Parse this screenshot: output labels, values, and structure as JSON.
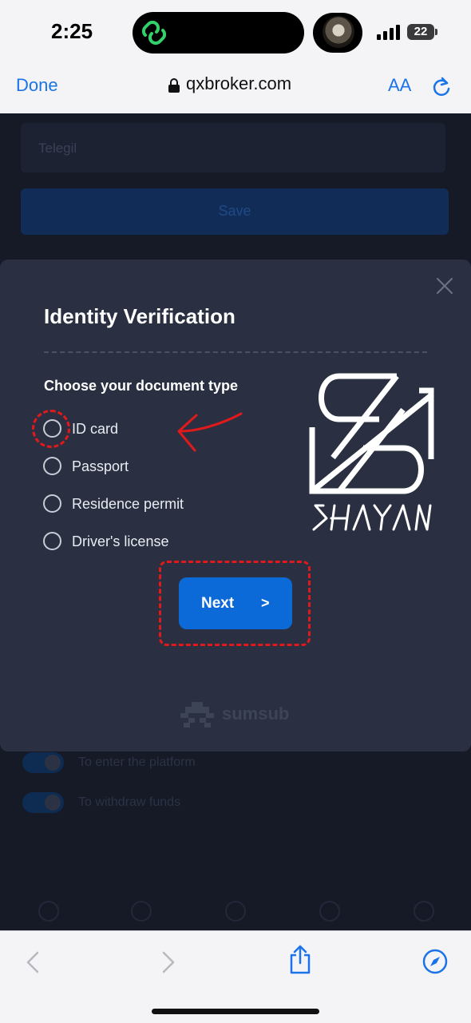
{
  "status_bar": {
    "time": "2:25",
    "battery": "22"
  },
  "browser": {
    "done_label": "Done",
    "url": "qxbroker.com",
    "text_size_label": "AA",
    "accent_color": "#1a73e8"
  },
  "background_page": {
    "input_placeholder": "Telegil",
    "save_label": "Save",
    "toggles": [
      {
        "label": "To enter the platform"
      },
      {
        "label": "To withdraw funds"
      }
    ]
  },
  "modal": {
    "title": "Identity Verification",
    "subtitle": "Choose your document type",
    "options": [
      {
        "label": "ID card",
        "selected": false
      },
      {
        "label": "Passport",
        "selected": false
      },
      {
        "label": "Residence permit",
        "selected": false
      },
      {
        "label": "Driver's license",
        "selected": false
      }
    ],
    "next_label": "Next",
    "next_arrow": ">",
    "provider": "sumsub",
    "button_color": "#0b6ad8"
  },
  "overlay": {
    "watermark_text": "SHAYAN",
    "annotation_color": "#e0191c"
  },
  "toolbar": {
    "icons": [
      "back-icon",
      "forward-icon",
      "share-icon",
      "compass-icon"
    ]
  }
}
